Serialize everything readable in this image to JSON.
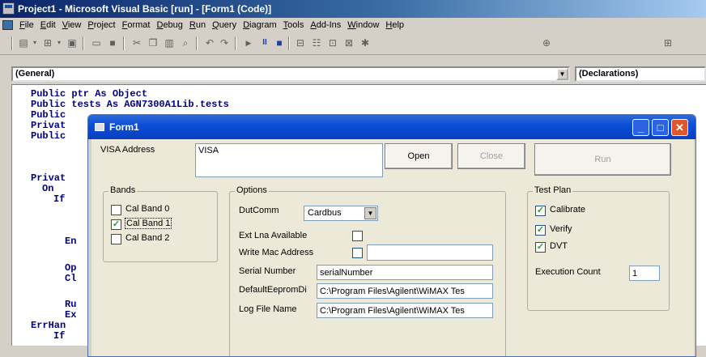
{
  "ide": {
    "title": "Project1 - Microsoft Visual Basic [run] - [Form1 (Code)]",
    "menu": [
      "File",
      "Edit",
      "View",
      "Project",
      "Format",
      "Debug",
      "Run",
      "Query",
      "Diagram",
      "Tools",
      "Add-Ins",
      "Window",
      "Help"
    ],
    "object_combo": "(General)",
    "proc_combo": "(Declarations)",
    "code_lines": [
      "Public ptr As Object",
      "Public tests As AGN7300A1Lib.tests",
      "Public",
      "Privat",
      "Public",
      "Privat",
      "On",
      "If",
      "En",
      "Op",
      "Cl",
      "Ru",
      "Ex",
      "ErrHan",
      "If"
    ]
  },
  "form1": {
    "title": "Form1",
    "visa_label": "VISA Address",
    "visa_value": "VISA",
    "open_label": "Open",
    "close_label": "Close",
    "run_label": "Run",
    "bands": {
      "title": "Bands",
      "items": [
        {
          "label": "Cal Band 0",
          "checked": false
        },
        {
          "label": "Cal Band 1",
          "checked": true
        },
        {
          "label": "Cal Band 2",
          "checked": false
        }
      ]
    },
    "options": {
      "title": "Options",
      "dutcomm_label": "DutComm",
      "dutcomm_value": "Cardbus",
      "ext_lna_label": "Ext Lna Available",
      "write_mac_label": "Write Mac Address",
      "write_mac_value": "",
      "serial_label": "Serial Number",
      "serial_value": "serialNumber",
      "eeprom_label": "DefaultEepromDi",
      "eeprom_value": "C:\\Program Files\\Agilent\\WiMAX Tes",
      "log_label": "Log File Name",
      "log_value": "C:\\Program Files\\Agilent\\WiMAX Tes"
    },
    "test_plan": {
      "title": "Test Plan",
      "items": [
        {
          "label": "Calibrate",
          "checked": true
        },
        {
          "label": "Verify",
          "checked": true
        },
        {
          "label": "DVT",
          "checked": true
        }
      ],
      "exec_label": "Execution Count",
      "exec_value": "1"
    }
  }
}
